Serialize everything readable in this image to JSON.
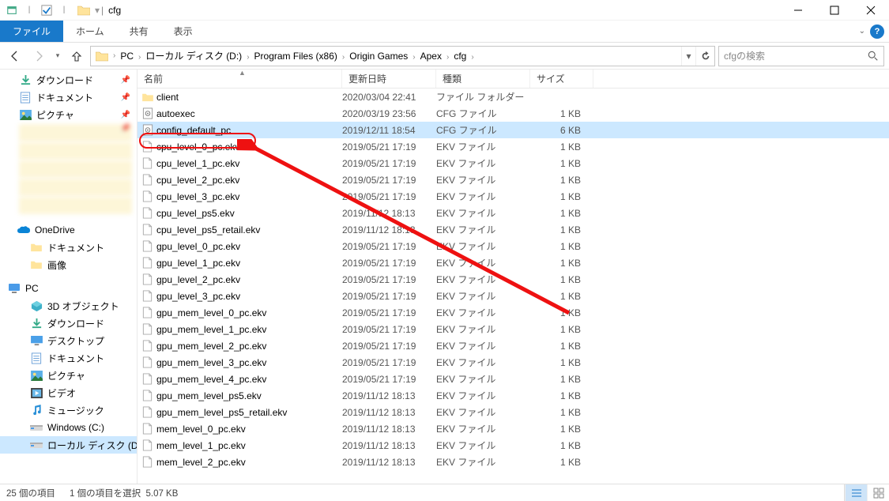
{
  "window": {
    "title": "cfg"
  },
  "ribbon": {
    "file": "ファイル",
    "tabs": [
      "ホーム",
      "共有",
      "表示"
    ]
  },
  "breadcrumbs": [
    "PC",
    "ローカル ディスク (D:)",
    "Program Files (x86)",
    "Origin Games",
    "Apex",
    "cfg"
  ],
  "search": {
    "placeholder": "cfgの検索"
  },
  "columns": {
    "name": "名前",
    "date": "更新日時",
    "type": "種類",
    "size": "サイズ"
  },
  "sidebar": {
    "quick": [
      {
        "label": "ダウンロード",
        "icon": "download",
        "pinned": true
      },
      {
        "label": "ドキュメント",
        "icon": "doc",
        "pinned": true
      },
      {
        "label": "ピクチャ",
        "icon": "picture",
        "pinned": true
      }
    ],
    "blurred_count": 5,
    "onedrive": {
      "label": "OneDrive",
      "children": [
        "ドキュメント",
        "画像"
      ]
    },
    "pc": {
      "label": "PC",
      "children": [
        {
          "label": "3D オブジェクト",
          "icon": "3d"
        },
        {
          "label": "ダウンロード",
          "icon": "download"
        },
        {
          "label": "デスクトップ",
          "icon": "desktop"
        },
        {
          "label": "ドキュメント",
          "icon": "doc"
        },
        {
          "label": "ピクチャ",
          "icon": "picture"
        },
        {
          "label": "ビデオ",
          "icon": "video"
        },
        {
          "label": "ミュージック",
          "icon": "music"
        },
        {
          "label": "Windows (C:)",
          "icon": "drive"
        },
        {
          "label": "ローカル ディスク (D",
          "icon": "drive",
          "selected": true
        }
      ]
    }
  },
  "files": [
    {
      "name": "client",
      "date": "2020/03/04 22:41",
      "type": "ファイル フォルダー",
      "size": "",
      "icon": "folder"
    },
    {
      "name": "autoexec",
      "date": "2020/03/19 23:56",
      "type": "CFG ファイル",
      "size": "1 KB",
      "icon": "cfg"
    },
    {
      "name": "config_default_pc",
      "date": "2019/12/11 18:54",
      "type": "CFG ファイル",
      "size": "6 KB",
      "icon": "cfg",
      "selected": true,
      "highlighted": true
    },
    {
      "name": "cpu_level_0_pc.ekv",
      "date": "2019/05/21 17:19",
      "type": "EKV ファイル",
      "size": "1 KB",
      "icon": "file"
    },
    {
      "name": "cpu_level_1_pc.ekv",
      "date": "2019/05/21 17:19",
      "type": "EKV ファイル",
      "size": "1 KB",
      "icon": "file"
    },
    {
      "name": "cpu_level_2_pc.ekv",
      "date": "2019/05/21 17:19",
      "type": "EKV ファイル",
      "size": "1 KB",
      "icon": "file"
    },
    {
      "name": "cpu_level_3_pc.ekv",
      "date": "2019/05/21 17:19",
      "type": "EKV ファイル",
      "size": "1 KB",
      "icon": "file"
    },
    {
      "name": "cpu_level_ps5.ekv",
      "date": "2019/11/12 18:13",
      "type": "EKV ファイル",
      "size": "1 KB",
      "icon": "file"
    },
    {
      "name": "cpu_level_ps5_retail.ekv",
      "date": "2019/11/12 18:13",
      "type": "EKV ファイル",
      "size": "1 KB",
      "icon": "file"
    },
    {
      "name": "gpu_level_0_pc.ekv",
      "date": "2019/05/21 17:19",
      "type": "EKV ファイル",
      "size": "1 KB",
      "icon": "file"
    },
    {
      "name": "gpu_level_1_pc.ekv",
      "date": "2019/05/21 17:19",
      "type": "EKV ファイル",
      "size": "1 KB",
      "icon": "file"
    },
    {
      "name": "gpu_level_2_pc.ekv",
      "date": "2019/05/21 17:19",
      "type": "EKV ファイル",
      "size": "1 KB",
      "icon": "file"
    },
    {
      "name": "gpu_level_3_pc.ekv",
      "date": "2019/05/21 17:19",
      "type": "EKV ファイル",
      "size": "1 KB",
      "icon": "file"
    },
    {
      "name": "gpu_mem_level_0_pc.ekv",
      "date": "2019/05/21 17:19",
      "type": "EKV ファイル",
      "size": "1 KB",
      "icon": "file"
    },
    {
      "name": "gpu_mem_level_1_pc.ekv",
      "date": "2019/05/21 17:19",
      "type": "EKV ファイル",
      "size": "1 KB",
      "icon": "file"
    },
    {
      "name": "gpu_mem_level_2_pc.ekv",
      "date": "2019/05/21 17:19",
      "type": "EKV ファイル",
      "size": "1 KB",
      "icon": "file"
    },
    {
      "name": "gpu_mem_level_3_pc.ekv",
      "date": "2019/05/21 17:19",
      "type": "EKV ファイル",
      "size": "1 KB",
      "icon": "file"
    },
    {
      "name": "gpu_mem_level_4_pc.ekv",
      "date": "2019/05/21 17:19",
      "type": "EKV ファイル",
      "size": "1 KB",
      "icon": "file"
    },
    {
      "name": "gpu_mem_level_ps5.ekv",
      "date": "2019/11/12 18:13",
      "type": "EKV ファイル",
      "size": "1 KB",
      "icon": "file"
    },
    {
      "name": "gpu_mem_level_ps5_retail.ekv",
      "date": "2019/11/12 18:13",
      "type": "EKV ファイル",
      "size": "1 KB",
      "icon": "file"
    },
    {
      "name": "mem_level_0_pc.ekv",
      "date": "2019/11/12 18:13",
      "type": "EKV ファイル",
      "size": "1 KB",
      "icon": "file"
    },
    {
      "name": "mem_level_1_pc.ekv",
      "date": "2019/11/12 18:13",
      "type": "EKV ファイル",
      "size": "1 KB",
      "icon": "file"
    },
    {
      "name": "mem_level_2_pc.ekv",
      "date": "2019/11/12 18:13",
      "type": "EKV ファイル",
      "size": "1 KB",
      "icon": "file"
    }
  ],
  "status": {
    "items": "25 個の項目",
    "selected": "1 個の項目を選択",
    "size": "5.07 KB"
  }
}
